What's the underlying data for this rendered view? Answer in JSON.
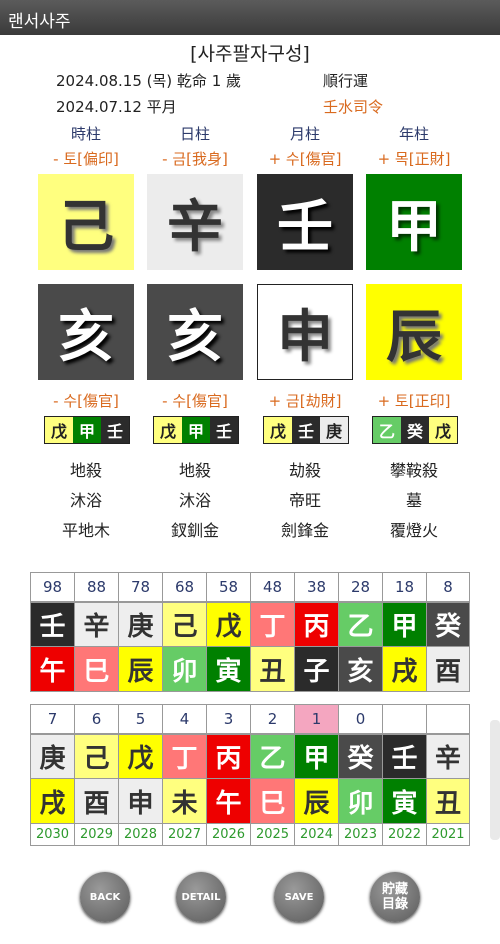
{
  "app": {
    "title": "랜서사주"
  },
  "header": {
    "title": "[사주팔자구성]",
    "solar_line": "2024.08.15  (목) 乾命 1 歲",
    "lunar_line": "2024.07.12 平月",
    "fortune_dir": "順行運",
    "commander": "壬水司令"
  },
  "pillars": [
    {
      "label": "時柱",
      "stem_rel": "- 토[偏印]",
      "stem": "己",
      "branch": "亥",
      "branch_rel": "- 수[傷官]",
      "hidden": [
        "戊",
        "甲",
        "壬"
      ],
      "spirit": "地殺",
      "stage": "沐浴",
      "nayin": "平地木"
    },
    {
      "label": "日柱",
      "stem_rel": "- 금[我身]",
      "stem": "辛",
      "branch": "亥",
      "branch_rel": "- 수[傷官]",
      "hidden": [
        "戊",
        "甲",
        "壬"
      ],
      "spirit": "地殺",
      "stage": "沐浴",
      "nayin": "釵釧金"
    },
    {
      "label": "月柱",
      "stem_rel": "+ 수[傷官]",
      "stem": "壬",
      "branch": "申",
      "branch_rel": "+ 금[劫財]",
      "hidden": [
        "戊",
        "壬",
        "庚"
      ],
      "spirit": "劫殺",
      "stage": "帝旺",
      "nayin": "劍鋒金"
    },
    {
      "label": "年柱",
      "stem_rel": "+ 목[正財]",
      "stem": "甲",
      "branch": "辰",
      "branch_rel": "+ 토[正印]",
      "hidden": [
        "乙",
        "癸",
        "戊"
      ],
      "spirit": "攀鞍殺",
      "stage": "墓",
      "nayin": "覆燈火"
    }
  ],
  "major_luck": {
    "ages": [
      "98",
      "88",
      "78",
      "68",
      "58",
      "48",
      "38",
      "28",
      "18",
      "8"
    ],
    "stems": [
      "壬",
      "辛",
      "庚",
      "己",
      "戊",
      "丁",
      "丙",
      "乙",
      "甲",
      "癸"
    ],
    "branches": [
      "午",
      "巳",
      "辰",
      "卯",
      "寅",
      "丑",
      "子",
      "亥",
      "戌",
      "酉"
    ]
  },
  "annual_luck": {
    "ages": [
      "7",
      "6",
      "5",
      "4",
      "3",
      "2",
      "1",
      "0",
      "",
      ""
    ],
    "stems": [
      "庚",
      "己",
      "戊",
      "丁",
      "丙",
      "乙",
      "甲",
      "癸",
      "壬",
      "辛"
    ],
    "branches": [
      "戌",
      "酉",
      "申",
      "未",
      "午",
      "巳",
      "辰",
      "卯",
      "寅",
      "丑"
    ],
    "years": [
      "2030",
      "2029",
      "2028",
      "2027",
      "2026",
      "2025",
      "2024",
      "2023",
      "2022",
      "2021"
    ]
  },
  "buttons": {
    "back": "BACK",
    "detail": "DETAIL",
    "save": "SAVE",
    "dir_line1": "貯藏",
    "dir_line2": "目錄"
  },
  "colors": {
    "earth": "#ffff7f",
    "earth_strong": "#ffff00",
    "metal": "#eeeeee",
    "water": "#2b2b2b",
    "wood": "#008000",
    "wood_light": "#66cc66",
    "fire": "#ee0000",
    "fire_light": "#ff7777",
    "highlight": "#f4a6c0"
  }
}
